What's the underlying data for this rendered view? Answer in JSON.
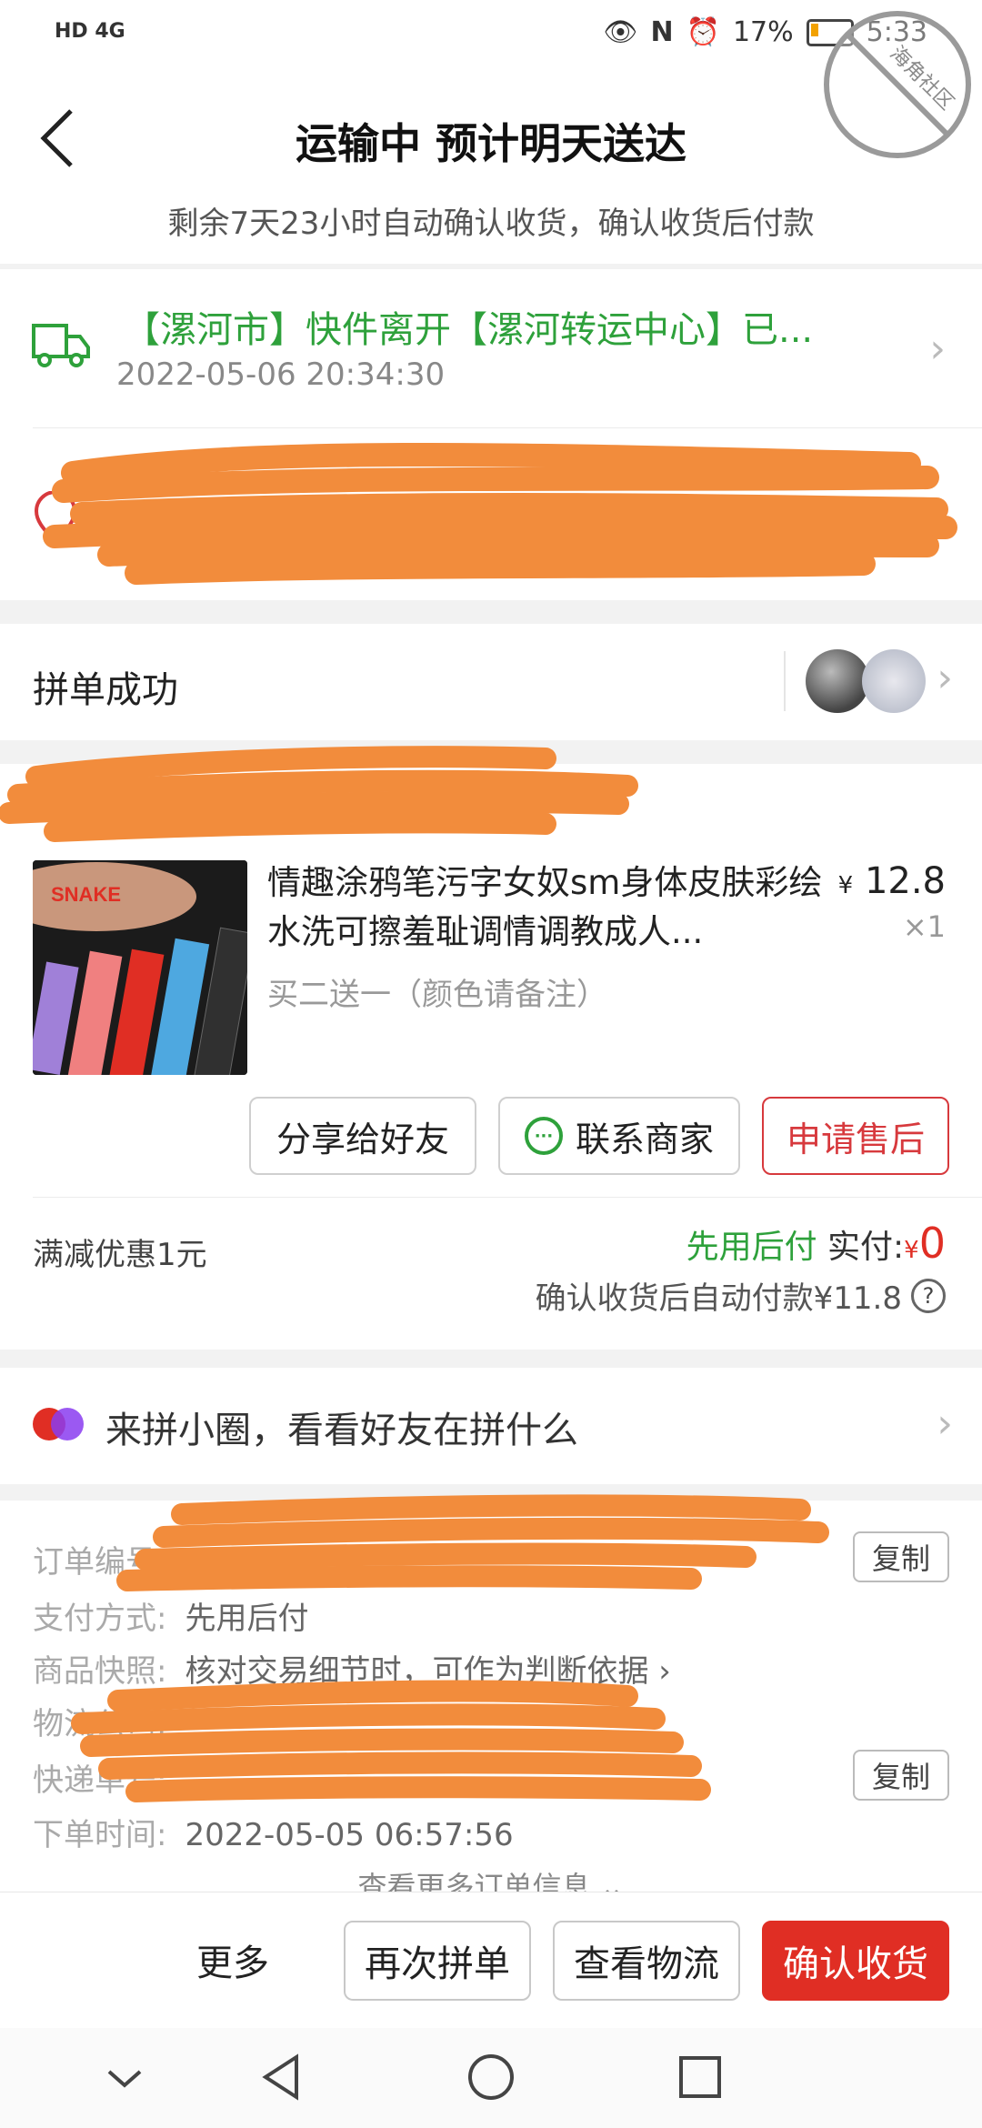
{
  "status_bar": {
    "network": "HD 4G",
    "battery": "17%",
    "time": "5:33"
  },
  "header": {
    "title": "运输中 预计明天送达",
    "subtitle": "剩余7天23小时自动确认收货，确认收货后付款"
  },
  "logistics": {
    "text": "【漯河市】快件离开【漯河转运中心】已...",
    "time": "2022-05-06 20:34:30"
  },
  "group": {
    "label": "拼单成功"
  },
  "product": {
    "title": "情趣涂鸦笔污字女奴sm身体皮肤彩绘水洗可擦羞耻调情调教成人...",
    "spec": "买二送一（颜色请备注）",
    "price_symbol": "¥",
    "price": "12.8",
    "qty": "×1",
    "share_label": "分享给好友",
    "contact_label": "联系商家",
    "aftersale_label": "申请售后"
  },
  "payment": {
    "discount": "满减优惠1元",
    "method_tag": "先用后付",
    "paid_label": "实付:",
    "paid_symbol": "¥",
    "paid_value": "0",
    "auto_pay": "确认收货后自动付款¥11.8"
  },
  "circle": {
    "text": "来拼小圈，看看好友在拼什么"
  },
  "order_info": {
    "order_no_label": "订单编号:",
    "pay_method_label": "支付方式:",
    "pay_method_value": "先用后付",
    "snapshot_label": "商品快照:",
    "snapshot_value": "核对交易细节时，可作为判断依据 ›",
    "courier_label": "物流公司:",
    "tracking_label": "快递单号:",
    "order_time_label": "下单时间:",
    "order_time_value": "2022-05-05 06:57:56",
    "copy_label": "复制",
    "more_label": "查看更多订单信息 ⌄"
  },
  "bottom_bar": {
    "more": "更多",
    "regroup": "再次拼单",
    "logistics": "查看物流",
    "confirm": "确认收货"
  },
  "watermark": {
    "text": "海角社区 haijiao.com"
  },
  "colors": {
    "brand_red": "#e02e24",
    "green": "#2ea13b",
    "scribble": "#f28c3c"
  }
}
